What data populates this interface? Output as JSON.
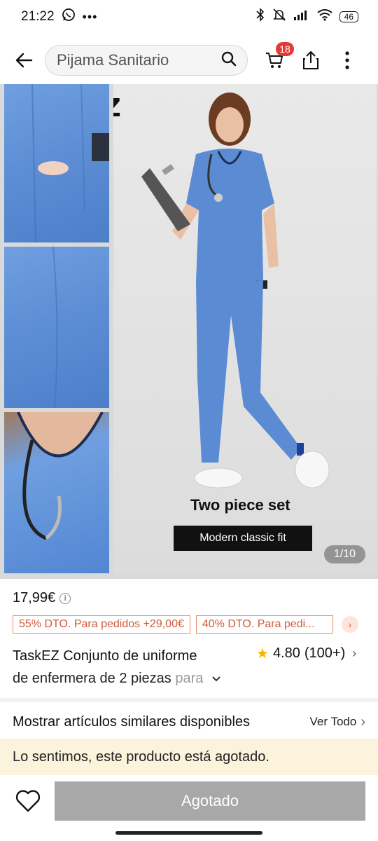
{
  "status_bar": {
    "time": "21:22",
    "battery": "46",
    "icons": [
      "whatsapp-icon",
      "more-notifications-icon",
      "bluetooth-icon",
      "mute-icon",
      "signal-icon",
      "wifi-icon",
      "battery-icon"
    ]
  },
  "nav": {
    "search_text": "Pijama Sanitario",
    "cart_count": "18"
  },
  "gallery": {
    "brand_logo": "TaskEZ",
    "set_title": "Two piece set",
    "fit_label": "Modern classic fit",
    "page_indicator": "1/10"
  },
  "product": {
    "price": "17,99€",
    "coupons": [
      "55% DTO. Para pedidos +29,00€",
      "40% DTO. Para pedi..."
    ],
    "title_line1": "TaskEZ Conjunto de uniforme",
    "title_line2_main": "de enfermera de 2 piezas ",
    "title_line2_faded": "para",
    "rating": "4.80",
    "review_count": "(100+)"
  },
  "similar": {
    "label": "Mostrar artículos similares disponibles",
    "see_all": "Ver Todo"
  },
  "notice": {
    "soldout_text": "Lo sentimos, este producto está agotado."
  },
  "bottom": {
    "button_label": "Agotado"
  },
  "colors": {
    "scrub_blue": "#5a8bd3",
    "coupon_red": "#d25a3a",
    "badge_red": "#e53935",
    "disabled_gray": "#a8a8a8",
    "notice_bg": "#fbf3dc",
    "star_yellow": "#f4b400"
  }
}
